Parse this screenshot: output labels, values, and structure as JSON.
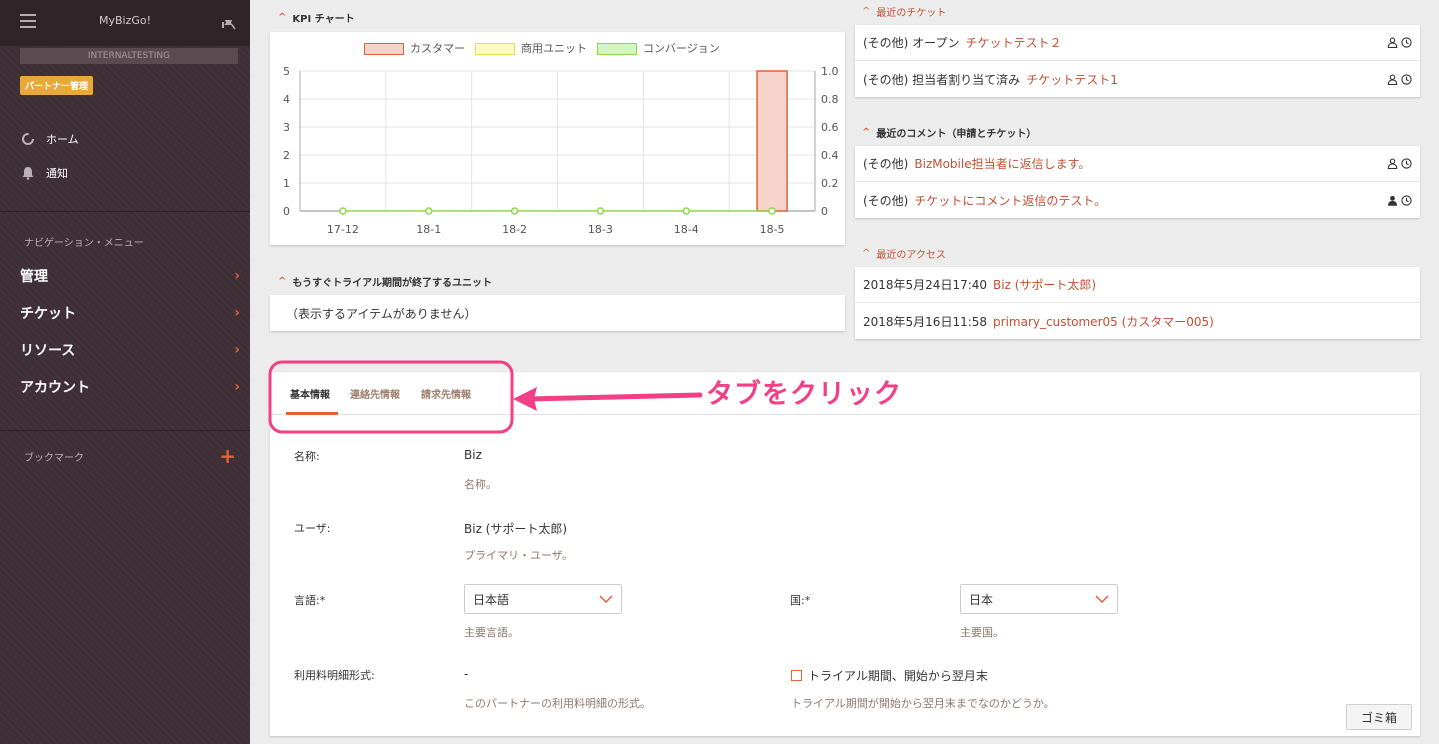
{
  "sidebar": {
    "app_title": "MyBizGo!",
    "tenant": "INTERNALTESTING",
    "badge": "パートナー管理",
    "home": "ホーム",
    "notifications": "通知",
    "nav_section": "ナビゲーション・メニュー",
    "nav": [
      "管理",
      "チケット",
      "リソース",
      "アカウント"
    ],
    "bookmarks": "ブックマーク"
  },
  "kpi": {
    "title": "KPI チャート",
    "chart_data": {
      "type": "bar",
      "categories": [
        "17-12",
        "18-1",
        "18-2",
        "18-3",
        "18-4",
        "18-5"
      ],
      "series": [
        {
          "name": "カスタマー",
          "type": "bar",
          "values": [
            0,
            0,
            0,
            0,
            0,
            5
          ],
          "color": "#f6d3cb",
          "stroke": "#e2623a"
        },
        {
          "name": "商用ユニット",
          "type": "bar",
          "values": [
            0,
            0,
            0,
            0,
            0,
            0
          ],
          "color": "#fbfbc0",
          "stroke": "#e3e35a"
        },
        {
          "name": "コンバージョン",
          "type": "line",
          "axis": "right",
          "values": [
            0,
            0,
            0,
            0,
            0,
            0
          ],
          "color": "#d2f5c4",
          "stroke": "#8dd84e"
        }
      ],
      "ylim": [
        0,
        5
      ],
      "y2lim": [
        0,
        1.0
      ],
      "yticks": [
        "5",
        "4",
        "3",
        "2",
        "1",
        "0"
      ],
      "y2ticks": [
        "1.0",
        "0.8",
        "0.6",
        "0.4",
        "0.2",
        "0"
      ],
      "grid": true,
      "legend": "top"
    }
  },
  "trial": {
    "title": "もうすぐトライアル期間が終了するユニット",
    "empty": "（表示するアイテムがありません）"
  },
  "tickets": {
    "title": "最近のチケット",
    "items": [
      {
        "status": "(その他) オープン",
        "link": "チケットテスト２"
      },
      {
        "status": "(その他) 担当者割り当て済み",
        "link": "チケットテスト1"
      }
    ]
  },
  "comments": {
    "title": "最近のコメント（申請とチケット）",
    "items": [
      {
        "status": "(その他)",
        "link": "BizMobile担当者に返信します。"
      },
      {
        "status": "(その他)",
        "link": "チケットにコメント返信のテスト。"
      }
    ]
  },
  "access": {
    "title": "最近のアクセス",
    "items": [
      {
        "time": "2018年5月24日17:40",
        "link": "Biz (サポート太郎)"
      },
      {
        "time": "2018年5月16日11:58",
        "link": "primary_customer05 (カスタマー005)"
      }
    ]
  },
  "tabs": [
    "基本情報",
    "連絡先情報",
    "請求先情報"
  ],
  "callout": "タブをクリック",
  "form": {
    "name_label": "名称:",
    "name_value": "Biz",
    "name_help": "名称。",
    "user_label": "ユーザ:",
    "user_value": "Biz (サポート太郎)",
    "user_help": "プライマリ・ユーザ。",
    "lang_label": "言語:*",
    "lang_value": "日本語",
    "lang_help": "主要言語。",
    "country_label": "国:*",
    "country_value": "日本",
    "country_help": "主要国。",
    "billing_label": "利用料明細形式:",
    "billing_value": "-",
    "billing_help": "このパートナーの利用料明細の形式。",
    "trial_check": "トライアル期間、開始から翌月末",
    "trial_help": "トライアル期間が開始から翌月末までなのかどうか。"
  },
  "trash": "ゴミ箱",
  "colors": {
    "accent": "#e2623a",
    "link": "#c44f33",
    "highlight": "#f23f86"
  }
}
